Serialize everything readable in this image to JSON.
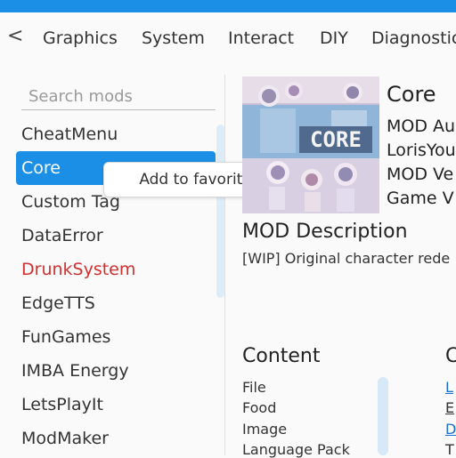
{
  "tabs": {
    "back": "<",
    "items": [
      "Graphics",
      "System",
      "Interact",
      "DIY",
      "Diagnostic"
    ]
  },
  "sidebar": {
    "search_placeholder": "Search mods",
    "items": [
      "CheatMenu",
      "Core",
      "Custom Tag",
      "DataError",
      "DrunkSystem",
      "EdgeTTS",
      "FunGames",
      "IMBA Energy",
      "LetsPlayIt",
      "ModMaker"
    ],
    "selected_index": 1
  },
  "tooltip": "Add to favorites",
  "detail": {
    "title": "Core",
    "preview_logo": "CORE",
    "meta": [
      "MOD Au",
      "LorisYou",
      "MOD Ve",
      "Game V"
    ],
    "description_title": "MOD Description",
    "description": "[WIP] Original character rede"
  },
  "content": {
    "title": "Content",
    "items": [
      "File",
      "Food",
      "Image",
      "Language Pack"
    ]
  },
  "right_col": {
    "title": "C",
    "items": [
      "L",
      "E",
      "D",
      "T"
    ]
  },
  "colors": {
    "accent": "#1b8fe6",
    "warning_item": "#d32f2f"
  }
}
